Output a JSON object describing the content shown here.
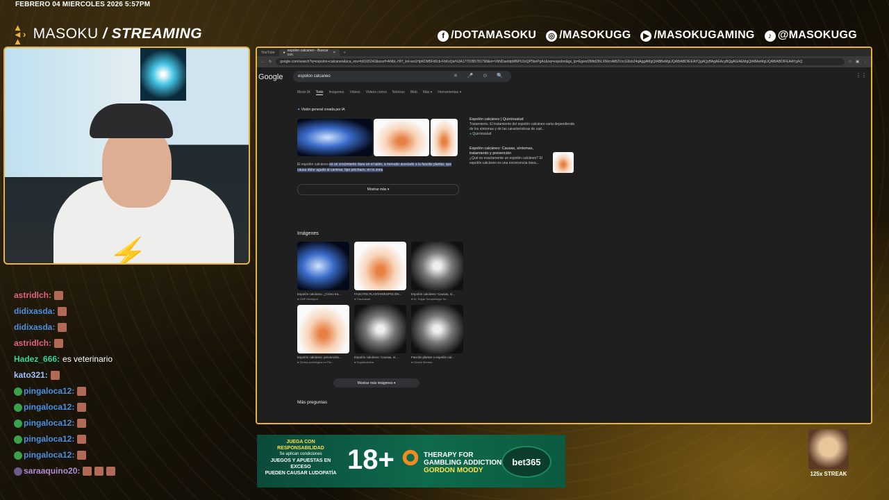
{
  "overlay": {
    "date": "FEBRERO 04 MIERCOLES 2026 5:57PM",
    "brand_name": "MASOKU",
    "brand_suffix": "/ STREAMING",
    "socials": [
      {
        "icon": "facebook-icon",
        "handle": "/DOTAMASOKU"
      },
      {
        "icon": "instagram-icon",
        "handle": "/MASOKUGG"
      },
      {
        "icon": "youtube-icon",
        "handle": "/MASOKUGAMING"
      },
      {
        "icon": "tiktok-icon",
        "handle": "@MASOKUGG"
      }
    ],
    "accent": "#e8b53a",
    "streak_label": "125x STREAK"
  },
  "chat": [
    {
      "user": "astridlch:",
      "color": "#e0627e",
      "text": "",
      "emote": true,
      "badge": ""
    },
    {
      "user": "didixasda:",
      "color": "#4b8fe2",
      "text": "",
      "emote": true,
      "badge": ""
    },
    {
      "user": "didixasda:",
      "color": "#4b8fe2",
      "text": "",
      "emote": true,
      "badge": ""
    },
    {
      "user": "astridlch:",
      "color": "#e0627e",
      "text": "",
      "emote": true,
      "badge": ""
    },
    {
      "user": "Hadez_666:",
      "color": "#35d39a",
      "text": "es veterinario",
      "emote": false,
      "badge": ""
    },
    {
      "user": "kato321:",
      "color": "#9fc3ff",
      "text": "",
      "emote": true,
      "badge": ""
    },
    {
      "user": "pingaloca12:",
      "color": "#4b8fe2",
      "text": "",
      "emote": true,
      "badge": "g"
    },
    {
      "user": "pingaloca12:",
      "color": "#4b8fe2",
      "text": "",
      "emote": true,
      "badge": "g"
    },
    {
      "user": "pingaloca12:",
      "color": "#4b8fe2",
      "text": "",
      "emote": true,
      "badge": "g"
    },
    {
      "user": "pingaloca12:",
      "color": "#4b8fe2",
      "text": "",
      "emote": true,
      "badge": "g"
    },
    {
      "user": "pingaloca12:",
      "color": "#4b8fe2",
      "text": "",
      "emote": true,
      "badge": "g"
    },
    {
      "user": "saraaquino20:",
      "color": "#b28ad8",
      "text": "",
      "emote": true,
      "badge": "p",
      "emotes": 3
    }
  ],
  "browser": {
    "tabs": [
      "YouTube",
      "espolon calcaneo - Buscar con"
    ],
    "url": "google.com/search?q=espolon+calcaneo&sca_esv=b9165242&sxsrf=ANbL-HIY_kvl-wo1HpKDM5Fd0cb-FbKxQw%3A1770285781798&ei=VbNDaeblpMNPU1kQP5bnPgAc&oq=espolon&gs_lp=Egxnd3Mtd2l6LXNlcnAiB2VzcG9sb24qAggAMgQIABBeMgUQABiABDIEEAYQgAQyBAgAEAcyBQgAGIAEMgQIABAeMgUQABiABDIFEAAYgAQ",
    "google_logo": "Google",
    "query": "espolon calcaneo",
    "search_tabs": [
      "Modo IA",
      "Todo",
      "Imágenes",
      "Videos",
      "Videos cortos",
      "Noticias",
      "Web",
      "Más ▾",
      "Herramientas ▾"
    ],
    "active_tab": "Todo",
    "ai_overview": {
      "label": "Visión general creada por IA",
      "text_plain": "El espolón calcáneo ",
      "text_highlight": "es un crecimiento óseo en el talón, a menudo asociado a la fascitis plantar, que causa dolor agudo al caminar, tipo pinchazo, en la zona",
      "show_more": "Mostrar más ▾"
    },
    "side_results": [
      {
        "title": "Espolón calcáneo | Quirónsalud",
        "snippet": "Tratamiento. El tratamiento del espolón calcáneo varía dependiendo de los síntomas y de las características de cad...",
        "source": "Quirónsalud"
      },
      {
        "title": "Espolón calcáneo: Causas, síntomas, tratamiento y prevención",
        "snippet": "¿Qué es exactamente un espolón calcáneo? El espolón calcáneo es una excrecencia ósea...",
        "source": ""
      }
    ],
    "images_heading": "Imágenes",
    "images": [
      {
        "caption": "Espolón calcáneo: ¿Cómo tra...",
        "source": "CMF Montijurá",
        "style": "xray"
      },
      {
        "caption": "FASCITIS PLANTAR/ESPOLÓN...",
        "source": "Traumasalt",
        "style": "illus"
      },
      {
        "caption": "Espolón calcáneo: Causas, sí...",
        "source": "Dr. Edgar Sempertegui So...",
        "style": "xray2"
      },
      {
        "caption": "Espolón calcáneo: prevención...",
        "source": "Clínica podológica en Pla...",
        "style": "illus"
      },
      {
        "caption": "Espolón calcáneo: Causas, sí...",
        "source": "Ergodinámica",
        "style": "xray2"
      },
      {
        "caption": "Fascitis plantar o espolón cal...",
        "source": "Clínica Moreau",
        "style": "xray2"
      }
    ],
    "show_more_images": "Mostrar más imágenes ▾",
    "more_questions": "Más preguntas"
  },
  "ad": {
    "line1": "JUEGA CON RESPONSABILIDAD",
    "line2": "Se aplican condiciones",
    "line3": "JUEGOS Y APUESTAS EN EXCESO",
    "line4": "PUEDEN CAUSAR LUDOPATÍA",
    "age": "18+",
    "therapy1": "THERAPY FOR",
    "therapy2": "GAMBLING ADDICTION",
    "therapy3": "GORDON MOODY",
    "brand": "bet365"
  }
}
